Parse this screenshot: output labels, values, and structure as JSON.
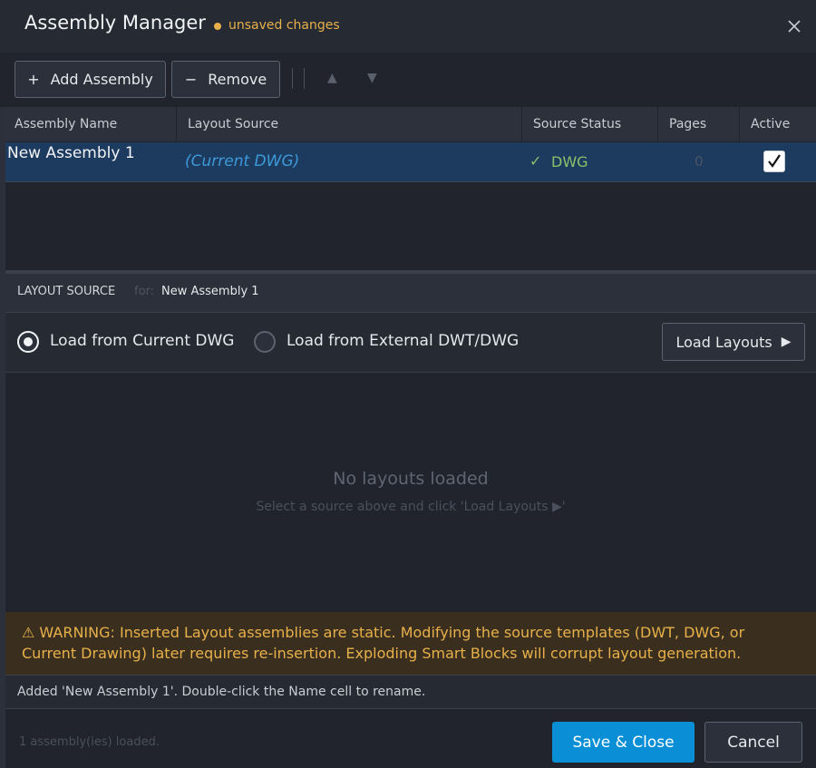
{
  "window": {
    "title": "Assembly Manager",
    "unsaved_label": "unsaved changes",
    "close_icon": "close-icon"
  },
  "toolbar": {
    "add_label": "Add Assembly",
    "add_glyph": "+",
    "remove_label": "Remove",
    "remove_glyph": "−",
    "move_up_glyph": "▲",
    "move_down_glyph": "▼"
  },
  "grid": {
    "columns": [
      "Assembly Name",
      "Layout Source",
      "Source Status",
      "Pages",
      "Active"
    ],
    "rows": [
      {
        "name": "New Assembly 1",
        "layout_source": "(Current DWG)",
        "status_glyph": "✓",
        "status": "DWG",
        "pages": "0",
        "active": true
      }
    ]
  },
  "layout_source": {
    "title": "LAYOUT SOURCE",
    "for_label": "for:",
    "assembly_name": "New Assembly 1",
    "option_current": "Load from Current DWG",
    "option_external": "Load from External DWT/DWG",
    "selected": "current",
    "load_button": "Load Layouts",
    "load_glyph": "▶",
    "empty_title": "No layouts loaded",
    "empty_hint": "Select a source above and click  'Load Layouts ▶'"
  },
  "warning": {
    "icon": "warning-icon",
    "text": "⚠ WARNING: Inserted Layout assemblies are static. Modifying the source templates (DWT, DWG, or Current Drawing) later requires re-insertion. Exploding Smart Blocks will corrupt layout generation."
  },
  "status_bar": {
    "message": "Added 'New Assembly 1'.  Double-click the Name cell to rename."
  },
  "footer": {
    "count_text": "1 assembly(ies) loaded.",
    "save_label": "Save & Close",
    "cancel_label": "Cancel"
  },
  "colors": {
    "accent": "#0a8fd6",
    "warning": "#e8b04a",
    "ok": "#8ac26a",
    "selected_row": "#1d3a5f"
  }
}
